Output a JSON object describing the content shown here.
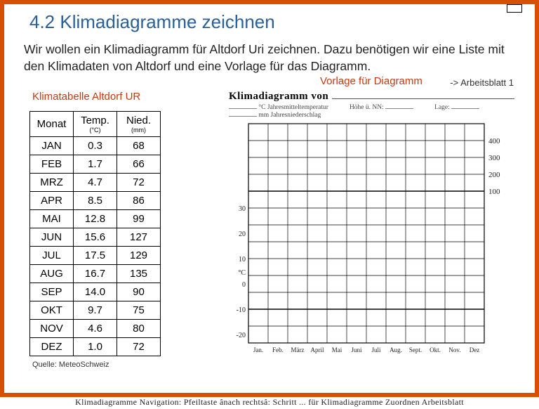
{
  "page_indicator": " ",
  "title": "4.2 Klimadiagramme zeichnen",
  "intro": "Wir wollen ein Klimadiagramm für Altdorf Uri zeichnen. Dazu benötigen wir eine Liste mit den Klimadaten von Altdorf und eine Vorlage für das Diagramm.",
  "worksheet_ref": "-> Arbeitsblatt 1",
  "table": {
    "caption": "Klimatabelle Altdorf UR",
    "headers": {
      "month": "Monat",
      "temp": "Temp.",
      "temp_unit": "(°C)",
      "nied": "Nied.",
      "nied_unit": "(mm)"
    },
    "rows": [
      {
        "month": "JAN",
        "temp": "0.3",
        "nied": "68"
      },
      {
        "month": "FEB",
        "temp": "1.7",
        "nied": "66"
      },
      {
        "month": "MRZ",
        "temp": "4.7",
        "nied": "72"
      },
      {
        "month": "APR",
        "temp": "8.5",
        "nied": "86"
      },
      {
        "month": "MAI",
        "temp": "12.8",
        "nied": "99"
      },
      {
        "month": "JUN",
        "temp": "15.6",
        "nied": "127"
      },
      {
        "month": "JUL",
        "temp": "17.5",
        "nied": "129"
      },
      {
        "month": "AUG",
        "temp": "16.7",
        "nied": "135"
      },
      {
        "month": "SEP",
        "temp": "14.0",
        "nied": "90"
      },
      {
        "month": "OKT",
        "temp": "9.7",
        "nied": "75"
      },
      {
        "month": "NOV",
        "temp": "4.6",
        "nied": "80"
      },
      {
        "month": "DEZ",
        "temp": "1.0",
        "nied": "72"
      }
    ],
    "source": "Quelle: MeteoSchweiz"
  },
  "diagram": {
    "caption": "Vorlage für Diagramm",
    "title_prefix": "Klimadiagramm von",
    "meta_temp": "°C Jahresmitteltemperatur",
    "meta_height": "Höhe ü. NN:",
    "meta_loc": "Lage:",
    "meta_precip": "mm Jahresniederschlag",
    "left_ticks": [
      "-20",
      "-10",
      "0",
      "°C",
      "10",
      "20",
      "30"
    ],
    "right_ticks": [
      "100",
      "200",
      "300",
      "400"
    ],
    "xlabels": [
      "Jan.",
      "Feb.",
      "März",
      "April",
      "Mai",
      "Juni",
      "Juli",
      "Aug.",
      "Sept.",
      "Okt.",
      "Nov.",
      "Dez"
    ]
  },
  "chart_data": {
    "type": "table",
    "title": "Klimatabelle Altdorf UR",
    "categories": [
      "JAN",
      "FEB",
      "MRZ",
      "APR",
      "MAI",
      "JUN",
      "JUL",
      "AUG",
      "SEP",
      "OKT",
      "NOV",
      "DEZ"
    ],
    "series": [
      {
        "name": "Temp. (°C)",
        "values": [
          0.3,
          1.7,
          4.7,
          8.5,
          12.8,
          15.6,
          17.5,
          16.7,
          14.0,
          9.7,
          4.6,
          1.0
        ]
      },
      {
        "name": "Nied. (mm)",
        "values": [
          68,
          66,
          72,
          86,
          99,
          127,
          129,
          135,
          90,
          75,
          80,
          72
        ]
      }
    ]
  },
  "footer": {
    "l": "Klimadiagramme Navigation: Pfeiltaste ânach rechtsâ: Schritt ...",
    "r": "für Klimadiagramme Zuordnen Arbeitsblatt"
  }
}
